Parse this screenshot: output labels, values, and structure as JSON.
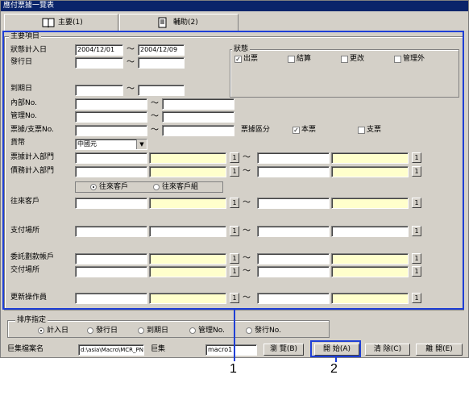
{
  "window": {
    "title": "應付票據一覽表"
  },
  "tabs": [
    {
      "label": "主要(1)",
      "icon": "book-icon"
    },
    {
      "label": "輔助(2)",
      "icon": "document-icon"
    }
  ],
  "main_group": {
    "legend": "主要項目"
  },
  "fields": {
    "post_date": {
      "label": "狀態計入日",
      "from": "2004/12/01",
      "to": "2004/12/09"
    },
    "issue_date": {
      "label": "發行日"
    },
    "due_date": {
      "label": "到期日"
    },
    "internal_no": {
      "label": "內部No."
    },
    "manage_no": {
      "label": "管理No."
    },
    "bill_no": {
      "label": "票據/支票No."
    },
    "currency": {
      "label": "貨幣",
      "value": "中國元"
    },
    "bill_dept": {
      "label": "票據計入部門"
    },
    "debt_dept": {
      "label": "債務計入部門"
    },
    "customer": {
      "label": "往來客戶"
    },
    "pay_place": {
      "label": "支付場所"
    },
    "trust_account": {
      "label": "委託劃款帳戶"
    },
    "delivery_place": {
      "label": "交付場所"
    },
    "updater": {
      "label": "更新操作員"
    }
  },
  "search_btn": "1",
  "tilde": "～",
  "status_group": {
    "legend": "狀態",
    "items": [
      {
        "label": "出票",
        "checked": true
      },
      {
        "label": "結算",
        "checked": false
      },
      {
        "label": "更改",
        "checked": false
      },
      {
        "label": "管理外",
        "checked": false
      }
    ]
  },
  "bill_type": {
    "label": "票據區分",
    "items": [
      {
        "label": "本票",
        "checked": true
      },
      {
        "label": "支票",
        "checked": false
      }
    ]
  },
  "customer_type": {
    "items": [
      {
        "label": "往來客戶",
        "selected": true
      },
      {
        "label": "往來客戶組",
        "selected": false
      }
    ]
  },
  "sort_group": {
    "legend": "排序指定",
    "items": [
      {
        "label": "計入日",
        "selected": true
      },
      {
        "label": "發行日",
        "selected": false
      },
      {
        "label": "到期日",
        "selected": false
      },
      {
        "label": "管理No.",
        "selected": false
      },
      {
        "label": "發行No.",
        "selected": false
      }
    ]
  },
  "footer": {
    "macro_file_label": "巨集檔案名",
    "macro_file_value": "d:\\asia\\Macro\\MCR_PN",
    "macro_label": "巨集",
    "macro_value": "macro1",
    "browse": "瀏 覽(B)",
    "start": "開 始(A)",
    "clear": "清 除(C)",
    "close": "離 開(E)"
  },
  "callouts": [
    "1",
    "2"
  ],
  "colors": {
    "highlight": "#1f3fd6",
    "yellow_field": "#ffffcc",
    "title_bar": "#0a246a"
  }
}
